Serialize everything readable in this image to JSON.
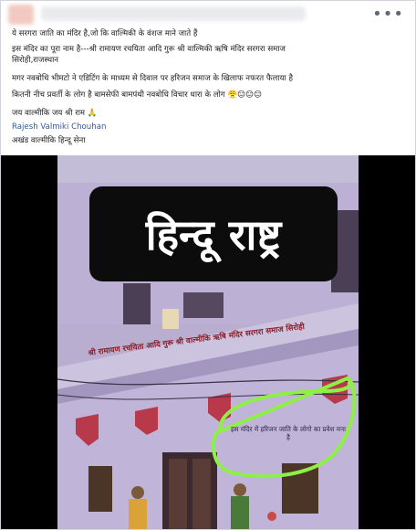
{
  "post": {
    "menu_icon": "more-horizontal-icon",
    "lines": [
      "ये सरगरा जाति का मंदिर है,जो कि वाल्मिकी के वंशज माने जाते हैं",
      "इस मंदिर का पूरा नाम है---श्री रामायण रचयिता आदि गुरू श्री वाल्मिकी ऋषि मंदिर सरगरा समाज",
      "सिरोही,राजस्थान",
      "मगर नवबोधि भीमटो ने एडिटिंग के माध्यम से दिवाल पर हरिजन समाज के खिलाफ नफरत फैलाया है",
      "कितनी नीच प्रवर्ती के लोग है बामसेफी बामपंथी नवबोधि विचार धारा के लोग 😤😑😑😑",
      "जय वाल्मीकि जय श्री राम 🙏"
    ],
    "author_link": "Rajesh Valmiki Chouhan",
    "footer": "अखंड वाल्मीकि हिन्दू सेना"
  },
  "image": {
    "overlay_text": "हिन्दू राष्ट्र",
    "facade_sign": "श्री रामायण रचयिता आदि गुरू श्री वाल्मीकि ऋषि मंदिर सरगरा समाज सिरोही",
    "notice_text": "इस मंदिर में हरिजन जाति के लोगो का प्रवेश मना है",
    "colors": {
      "wall": "#b9aed0",
      "highlight_circle": "#8ef046",
      "sign_text": "#8c1f2a"
    }
  }
}
